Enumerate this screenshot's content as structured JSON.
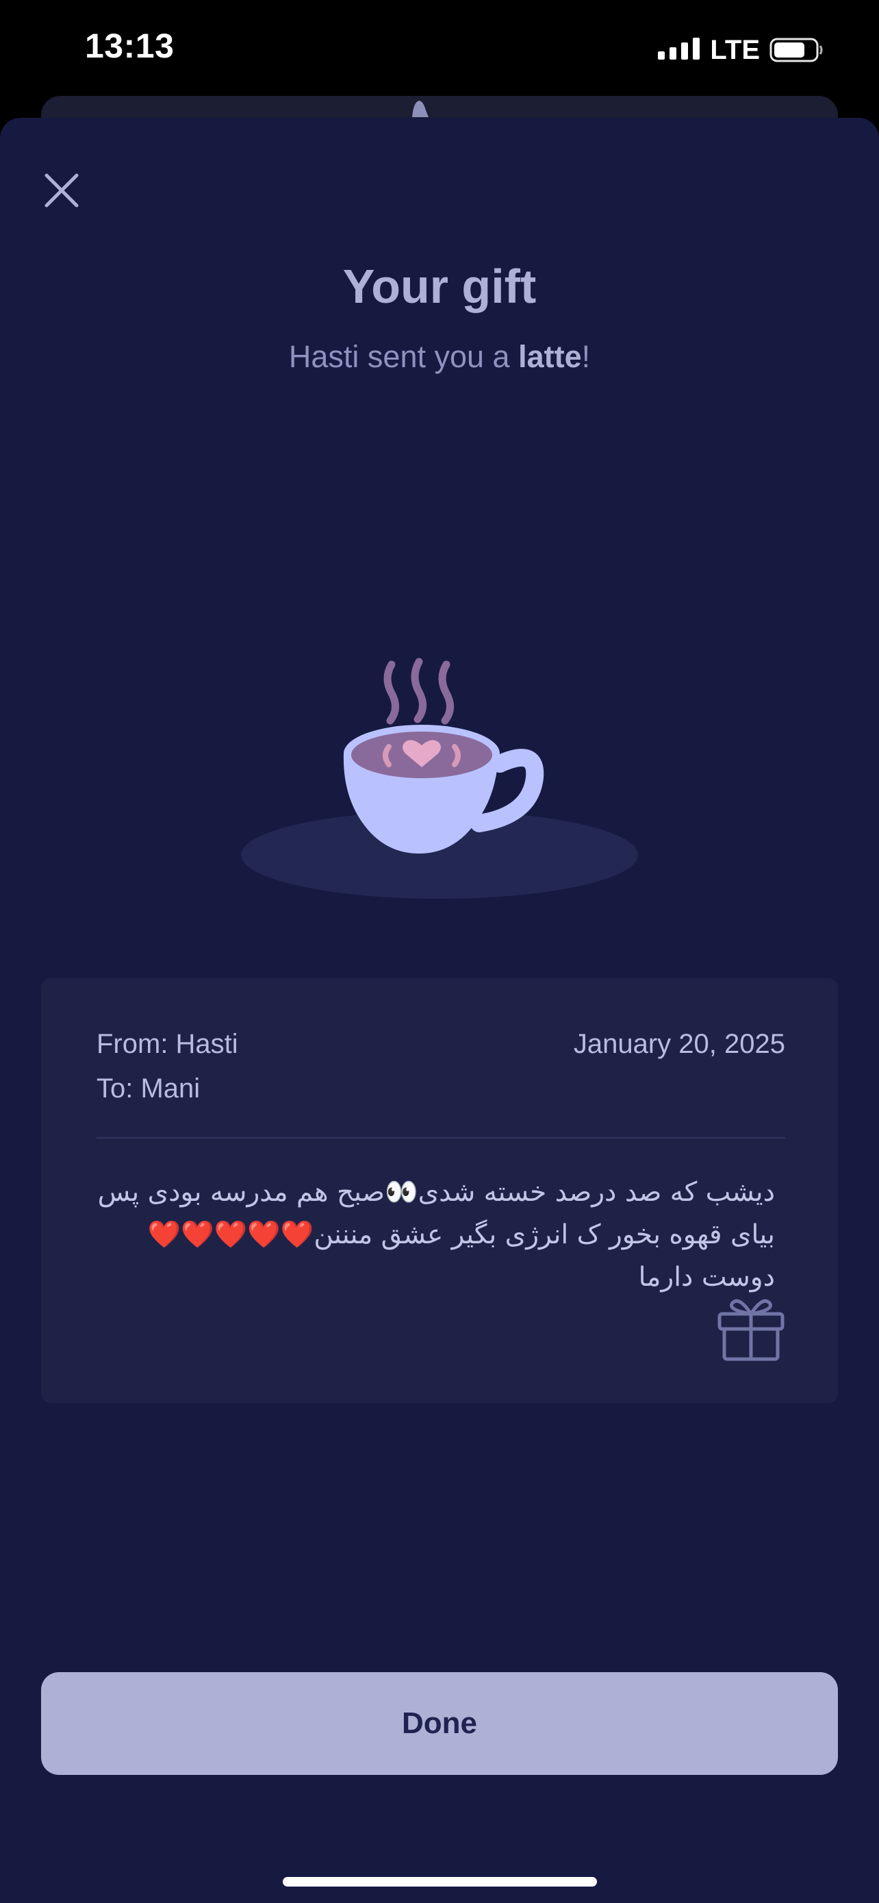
{
  "status_bar": {
    "time": "13:13",
    "network": "LTE",
    "signal_icon": "signal-bars-icon",
    "battery_icon": "battery-icon"
  },
  "sheet": {
    "close_icon": "close-icon",
    "title": "Your gift",
    "subtitle_prefix": "Hasti sent you a ",
    "subtitle_item": "latte",
    "subtitle_suffix": "!"
  },
  "illustration": {
    "icon": "latte-cup-icon"
  },
  "message_card": {
    "from": "From: Hasti",
    "to": "To: Mani",
    "date": "January 20, 2025",
    "message": "دیشب که صد درصد خسته شدی👀صبح هم مدرسه بودی پس بیای قهوه بخور ک انرژی بگیر عشق منننن❤️❤️❤️❤️❤️دوست دارما",
    "gift_icon": "gift-icon"
  },
  "actions": {
    "done_label": "Done"
  },
  "colors": {
    "sheet_background": "#161a41",
    "card_background": "#1e2247",
    "button_background": "#adb1d5",
    "title_text": "#aeb1d6",
    "cup_body": "#b9c2ff",
    "coffee_surface": "#8a6a9a"
  }
}
